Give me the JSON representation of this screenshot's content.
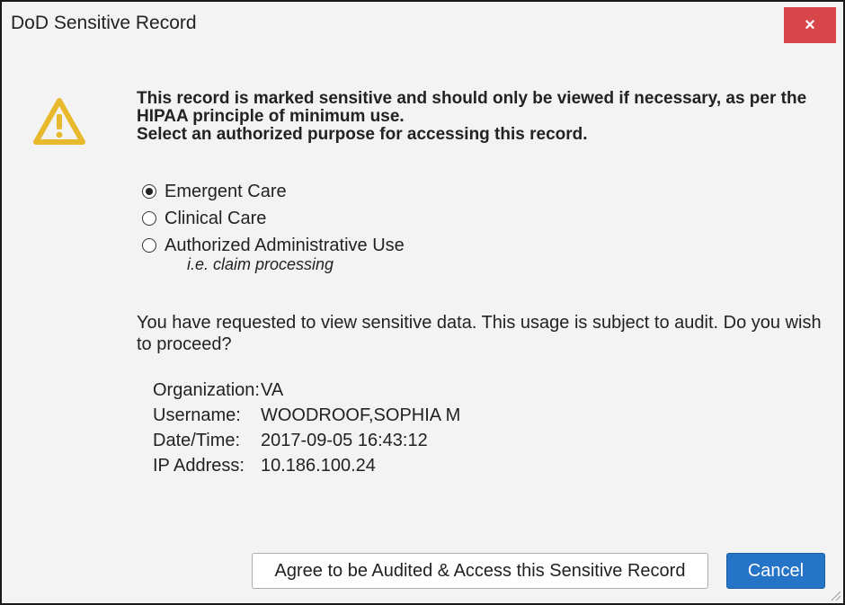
{
  "dialog": {
    "title": "DoD Sensitive Record",
    "close_label": "×"
  },
  "warning": {
    "icon": "warning-triangle-icon",
    "color": "#e8b92c",
    "line1": "This record is marked sensitive and should only be viewed if necessary, as per the",
    "line2": "HIPAA principle of minimum use.",
    "line3": "Select an authorized purpose for accessing this record."
  },
  "purpose_options": [
    {
      "label": "Emergent Care",
      "checked": true
    },
    {
      "label": "Clinical Care",
      "checked": false
    },
    {
      "label": "Authorized Administrative Use",
      "checked": false,
      "hint": "i.e. claim processing"
    }
  ],
  "notice": "You have requested to view sensitive data. This usage is subject to audit. Do you wish to proceed?",
  "audit_info": [
    {
      "key": "Organization:",
      "value": "VA"
    },
    {
      "key": "Username:",
      "value": "WOODROOF,SOPHIA M"
    },
    {
      "key": "Date/Time:",
      "value": "2017-09-05 16:43:12"
    },
    {
      "key": "IP Address:",
      "value": "10.186.100.24"
    }
  ],
  "buttons": {
    "agree_label": "Agree to be Audited & Access this Sensitive Record",
    "cancel_label": "Cancel"
  },
  "colors": {
    "close": "#d9464a",
    "primary": "#2674c8"
  }
}
